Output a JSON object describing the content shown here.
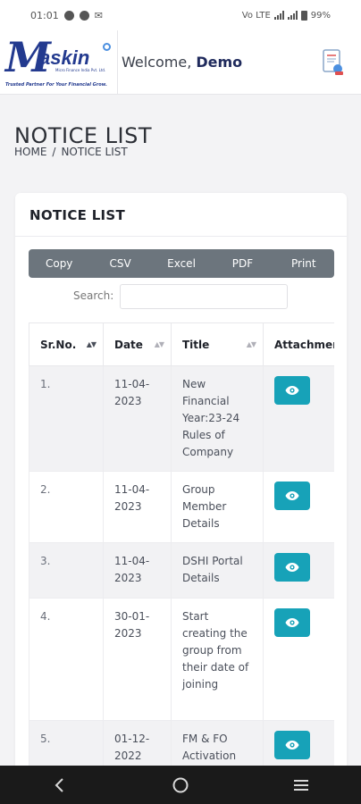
{
  "status_bar": {
    "time": "01:01",
    "battery_text": "99%",
    "network_text": "Vo LTE"
  },
  "header": {
    "logo_word": "askin",
    "logo_sub": "Micro Finance India Pvt. Ltd.",
    "logo_tagline": "Trusted Partner For Your Financial Grow.",
    "welcome_prefix": "Welcome,",
    "user_name": "Demo"
  },
  "page": {
    "title": "NOTICE LIST",
    "breadcrumb": {
      "home": "HOME",
      "separator": "/",
      "current": "NOTICE LIST"
    }
  },
  "card": {
    "title": "NOTICE LIST",
    "buttons": {
      "copy": "Copy",
      "csv": "CSV",
      "excel": "Excel",
      "pdf": "PDF",
      "print": "Print"
    },
    "search_label": "Search:",
    "search_value": ""
  },
  "table": {
    "columns": {
      "sr_no": "Sr.No.",
      "date": "Date",
      "title": "Title",
      "attachment": "Attachment"
    },
    "rows": [
      {
        "sr": "1.",
        "date": "11-04-2023",
        "title": "New Financial Year:23-24 Rules of Company"
      },
      {
        "sr": "2.",
        "date": "11-04-2023",
        "title": "Group Member Details"
      },
      {
        "sr": "3.",
        "date": "11-04-2023",
        "title": "DSHI Portal Details"
      },
      {
        "sr": "4.",
        "date": "30-01-2023",
        "title": "Start creating the group from their date of joining"
      },
      {
        "sr": "5.",
        "date": "01-12-2022",
        "title": "FM & FO Activation"
      }
    ]
  },
  "colors": {
    "accent_button": "#17a2b8",
    "export_bar": "#6c757d",
    "brand": "#233a8f"
  }
}
